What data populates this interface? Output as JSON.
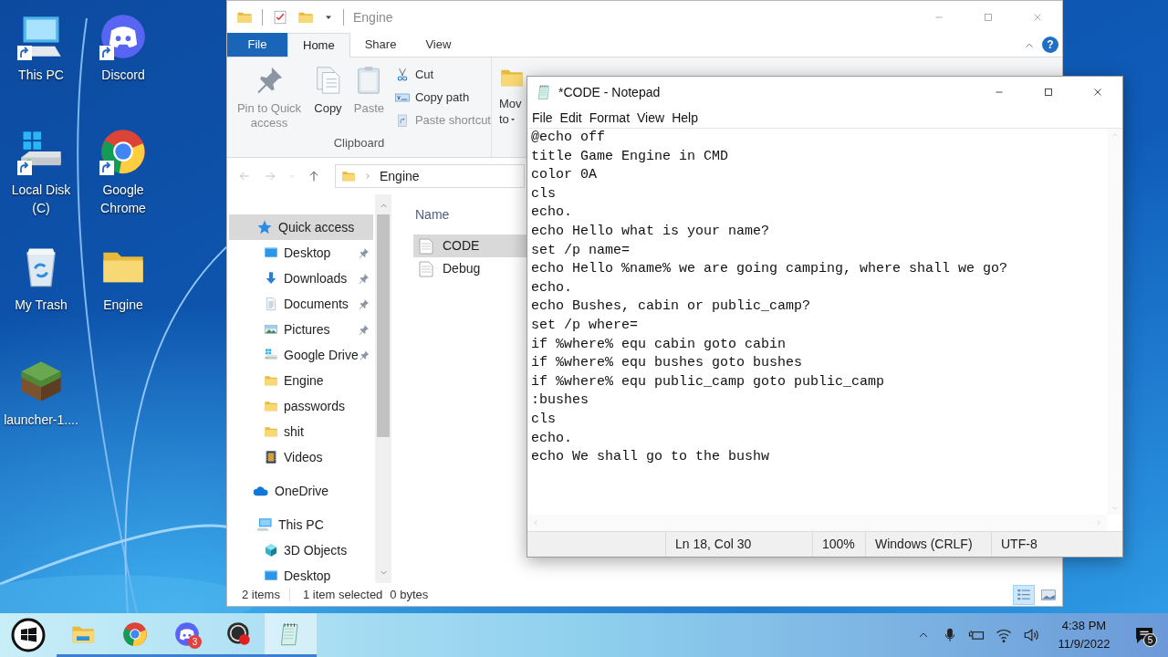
{
  "desktop": {
    "icons": [
      {
        "label": "This PC",
        "kind": "computer",
        "shortcut": true
      },
      {
        "label": "Discord",
        "kind": "discord",
        "shortcut": true
      },
      {
        "label": "Local Disk (C)",
        "kind": "drive",
        "shortcut": true
      },
      {
        "label": "Google Chrome",
        "kind": "chrome",
        "shortcut": true
      },
      {
        "label": "My Trash",
        "kind": "trash",
        "shortcut": false
      },
      {
        "label": "Engine",
        "kind": "folder",
        "shortcut": false
      },
      {
        "label": "launcher-1....",
        "kind": "block",
        "shortcut": false
      }
    ]
  },
  "explorer": {
    "title": "Engine",
    "tabs": [
      {
        "label": "File",
        "kind": "file",
        "selected": false
      },
      {
        "label": "Home",
        "kind": "tab",
        "selected": true
      },
      {
        "label": "Share",
        "kind": "tab",
        "selected": false
      },
      {
        "label": "View",
        "kind": "tab",
        "selected": false
      }
    ],
    "help": "?",
    "ribbon": {
      "large": [
        {
          "label": "Pin to Quick access",
          "kind": "pin",
          "disabled": true
        },
        {
          "label": "Copy",
          "kind": "copy",
          "disabled": false
        },
        {
          "label": "Paste",
          "kind": "paste",
          "disabled": true
        }
      ],
      "small": [
        {
          "label": "Cut",
          "kind": "cut",
          "disabled": false
        },
        {
          "label": "Copy path",
          "kind": "path",
          "disabled": false
        },
        {
          "label": "Paste shortcut",
          "kind": "shortcut",
          "disabled": true
        }
      ],
      "group": "Clipboard",
      "move": {
        "label": "Mov",
        "sub": "to"
      }
    },
    "address": "Engine",
    "nav": [
      {
        "label": "Quick access",
        "kind": "star",
        "selected": true,
        "pinned": false,
        "children": [
          {
            "label": "Desktop",
            "kind": "desktop",
            "selected": false,
            "pinned": true
          },
          {
            "label": "Downloads",
            "kind": "download",
            "selected": false,
            "pinned": true
          },
          {
            "label": "Documents",
            "kind": "document",
            "selected": false,
            "pinned": true
          },
          {
            "label": "Pictures",
            "kind": "picture",
            "selected": false,
            "pinned": true
          },
          {
            "label": "Google Drive",
            "kind": "drive",
            "selected": false,
            "pinned": true
          },
          {
            "label": "Engine",
            "kind": "folder",
            "selected": false,
            "pinned": false
          },
          {
            "label": "passwords",
            "kind": "folder",
            "selected": false,
            "pinned": false
          },
          {
            "label": "shit",
            "kind": "folder",
            "selected": false,
            "pinned": false
          },
          {
            "label": "Videos",
            "kind": "video",
            "selected": false,
            "pinned": false
          }
        ]
      },
      {
        "label": "OneDrive",
        "kind": "cloud",
        "selected": false,
        "pinned": false
      },
      {
        "label": "This PC",
        "kind": "pc",
        "selected": false,
        "pinned": false,
        "children": [
          {
            "label": "3D Objects",
            "kind": "cube",
            "selected": false,
            "pinned": false
          },
          {
            "label": "Desktop",
            "kind": "desktop",
            "selected": false,
            "pinned": false
          }
        ]
      }
    ],
    "column": "Name",
    "files": [
      {
        "name": "CODE",
        "selected": true
      },
      {
        "name": "Debug",
        "selected": false
      }
    ],
    "status": [
      "2 items",
      "1 item selected",
      "0 bytes"
    ],
    "views": [
      {
        "kind": "details",
        "selected": true
      },
      {
        "kind": "tiles",
        "selected": false
      }
    ]
  },
  "notepad": {
    "title": "*CODE - Notepad",
    "menu": [
      "File",
      "Edit",
      "Format",
      "View",
      "Help"
    ],
    "lines": [
      "@echo off",
      "title Game Engine in CMD",
      "color 0A",
      "cls",
      "echo.",
      "echo Hello what is your name?",
      "set /p name=",
      "echo Hello %name% we are going camping, where shall we go?",
      "echo.",
      "echo Bushes, cabin or public_camp?",
      "set /p where=",
      "if %where% equ cabin goto cabin",
      "if %where% equ bushes goto bushes",
      "if %where% equ public_camp goto public_camp",
      ":bushes",
      "cls",
      "echo.",
      "echo We shall go to the bushw"
    ],
    "status": [
      "Ln 18, Col 30",
      "100%",
      "Windows (CRLF)",
      "UTF-8"
    ]
  },
  "taskbar": {
    "apps": [
      {
        "kind": "explorer",
        "active": false
      },
      {
        "kind": "chrome",
        "active": false
      },
      {
        "kind": "discord",
        "active": false,
        "badge": "3"
      },
      {
        "kind": "obs",
        "active": false
      },
      {
        "kind": "notepad",
        "active": true
      }
    ],
    "time": "4:38 PM",
    "date": "11/9/2022",
    "notifications": "5"
  }
}
